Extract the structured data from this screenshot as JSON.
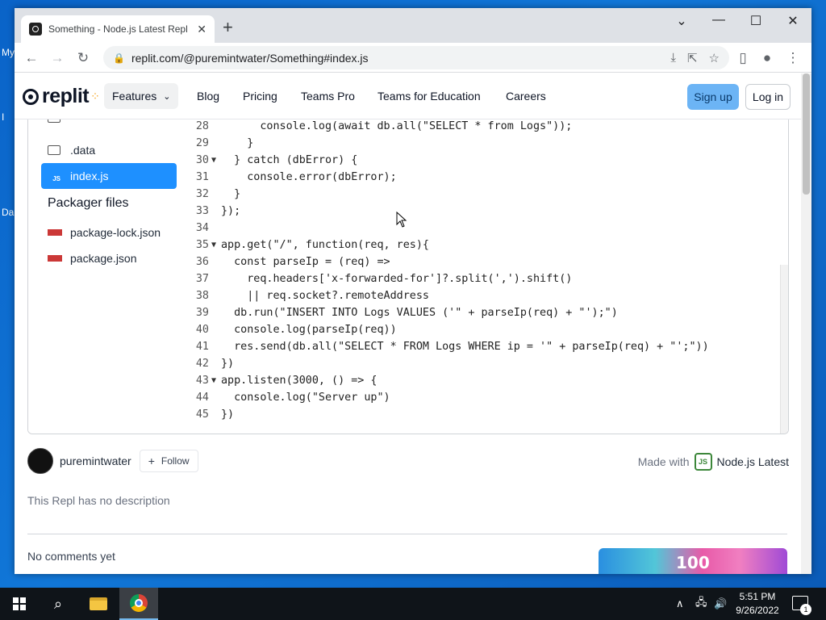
{
  "desktop": {
    "icon_labels": [
      "My",
      "I",
      "Da"
    ]
  },
  "browser": {
    "tab": {
      "title": "Something - Node.js Latest Repl"
    },
    "window_controls": {
      "minimize": "—",
      "maximize": "☐",
      "close": "✕",
      "tab_list": "⌄"
    },
    "url": "replit.com/@puremintwater/Something#index.js"
  },
  "site_nav": {
    "logo": "replit",
    "features": "Features",
    "links": [
      "Blog",
      "Pricing",
      "Teams Pro",
      "Teams for Education",
      "Careers"
    ],
    "signup": "Sign up",
    "login": "Log in"
  },
  "filetree": {
    "items": [
      ".data",
      "index.js"
    ],
    "packager_title": "Packager files",
    "packager_items": [
      "package-lock.json",
      "package.json"
    ]
  },
  "code": {
    "lines": [
      {
        "n": "28",
        "fold": "",
        "text": "      console.log(await db.all(\"SELECT * from Logs\"));"
      },
      {
        "n": "29",
        "fold": "",
        "text": "    }"
      },
      {
        "n": "30",
        "fold": "▼",
        "text": "  } catch (dbError) {"
      },
      {
        "n": "31",
        "fold": "",
        "text": "    console.error(dbError);"
      },
      {
        "n": "32",
        "fold": "",
        "text": "  }"
      },
      {
        "n": "33",
        "fold": "",
        "text": "});"
      },
      {
        "n": "34",
        "fold": "",
        "text": ""
      },
      {
        "n": "35",
        "fold": "▼",
        "text": "app.get(\"/\", function(req, res){"
      },
      {
        "n": "36",
        "fold": "",
        "text": "  const parseIp = (req) =>"
      },
      {
        "n": "37",
        "fold": "",
        "text": "    req.headers['x-forwarded-for']?.split(',').shift()"
      },
      {
        "n": "38",
        "fold": "",
        "text": "    || req.socket?.remoteAddress"
      },
      {
        "n": "39",
        "fold": "",
        "text": "  db.run(\"INSERT INTO Logs VALUES ('\" + parseIp(req) + \"');\")"
      },
      {
        "n": "40",
        "fold": "",
        "text": "  console.log(parseIp(req))"
      },
      {
        "n": "41",
        "fold": "",
        "text": "  res.send(db.all(\"SELECT * FROM Logs WHERE ip = '\" + parseIp(req) + \"';\"))"
      },
      {
        "n": "42",
        "fold": "",
        "text": "})"
      },
      {
        "n": "43",
        "fold": "▼",
        "text": "app.listen(3000, () => {"
      },
      {
        "n": "44",
        "fold": "",
        "text": "  console.log(\"Server up\")"
      },
      {
        "n": "45",
        "fold": "",
        "text": "})"
      }
    ]
  },
  "repl_meta": {
    "author": "puremintwater",
    "follow": "Follow",
    "made_with": "Made with",
    "language": "Node.js Latest",
    "description": "This Repl has no description",
    "comments": "No comments yet",
    "promo_text": "100"
  },
  "taskbar": {
    "time": "5:51 PM",
    "date": "9/26/2022",
    "notification_count": "1"
  }
}
